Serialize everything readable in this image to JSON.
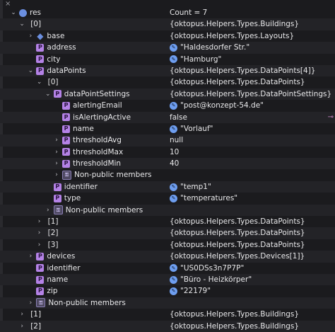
{
  "top_close": "×",
  "pencil_glyph": "✎",
  "rows": [
    {
      "indent": 0,
      "chev": "⌄",
      "icon": "obj",
      "icon_text": "",
      "name": "res",
      "value": "Count = 7",
      "pencil": false
    },
    {
      "indent": 1,
      "chev": "⌄",
      "icon": "none",
      "icon_text": "",
      "name": "[0]",
      "value": "{oktopus.Helpers.Types.Buildings}",
      "pencil": false
    },
    {
      "indent": 2,
      "chev": "›",
      "icon": "base",
      "icon_text": "◆",
      "name": "base",
      "value": "{oktopus.Helpers.Types.Layouts}",
      "pencil": false
    },
    {
      "indent": 2,
      "chev": "",
      "icon": "p",
      "icon_text": "P",
      "name": "address",
      "value": "\"Haldesdorfer Str.\"",
      "pencil": true
    },
    {
      "indent": 2,
      "chev": "",
      "icon": "p",
      "icon_text": "P",
      "name": "city",
      "value": "\"Hamburg\"",
      "pencil": true
    },
    {
      "indent": 2,
      "chev": "⌄",
      "icon": "p",
      "icon_text": "P",
      "name": "dataPoints",
      "value": "{oktopus.Helpers.Types.DataPoints[4]}",
      "pencil": false
    },
    {
      "indent": 3,
      "chev": "⌄",
      "icon": "none",
      "icon_text": "",
      "name": "[0]",
      "value": "{oktopus.Helpers.Types.DataPoints}",
      "pencil": false
    },
    {
      "indent": 4,
      "chev": "⌄",
      "icon": "p",
      "icon_text": "P",
      "name": "dataPointSettings",
      "value": "{oktopus.Helpers.Types.DataPointSettings}",
      "pencil": false
    },
    {
      "indent": 5,
      "chev": "",
      "icon": "p",
      "icon_text": "P",
      "name": "alertingEmail",
      "value": "\"post@konzept-54.de\"",
      "pencil": true
    },
    {
      "indent": 5,
      "chev": "",
      "icon": "p",
      "icon_text": "P",
      "name": "isAlertingActive",
      "value": "false",
      "pencil": false,
      "marker": true
    },
    {
      "indent": 5,
      "chev": "",
      "icon": "p",
      "icon_text": "P",
      "name": "name",
      "value": "\"Vorlauf\"",
      "pencil": true
    },
    {
      "indent": 5,
      "chev": "›",
      "icon": "p",
      "icon_text": "P",
      "name": "thresholdAvg",
      "value": "null",
      "pencil": false
    },
    {
      "indent": 5,
      "chev": "›",
      "icon": "p",
      "icon_text": "P",
      "name": "thresholdMax",
      "value": "10",
      "pencil": false
    },
    {
      "indent": 5,
      "chev": "›",
      "icon": "p",
      "icon_text": "P",
      "name": "thresholdMin",
      "value": "40",
      "pencil": false
    },
    {
      "indent": 5,
      "chev": "›",
      "icon": "np",
      "icon_text": "⚿",
      "name": "Non-public members",
      "value": "",
      "pencil": false
    },
    {
      "indent": 4,
      "chev": "",
      "icon": "p",
      "icon_text": "P",
      "name": "identifier",
      "value": "\"temp1\"",
      "pencil": true
    },
    {
      "indent": 4,
      "chev": "",
      "icon": "p",
      "icon_text": "P",
      "name": "type",
      "value": "\"temperatures\"",
      "pencil": true
    },
    {
      "indent": 4,
      "chev": "›",
      "icon": "np",
      "icon_text": "⚿",
      "name": "Non-public members",
      "value": "",
      "pencil": false
    },
    {
      "indent": 3,
      "chev": "›",
      "icon": "none",
      "icon_text": "",
      "name": "[1]",
      "value": "{oktopus.Helpers.Types.DataPoints}",
      "pencil": false
    },
    {
      "indent": 3,
      "chev": "›",
      "icon": "none",
      "icon_text": "",
      "name": "[2]",
      "value": "{oktopus.Helpers.Types.DataPoints}",
      "pencil": false
    },
    {
      "indent": 3,
      "chev": "›",
      "icon": "none",
      "icon_text": "",
      "name": "[3]",
      "value": "{oktopus.Helpers.Types.DataPoints}",
      "pencil": false
    },
    {
      "indent": 2,
      "chev": "›",
      "icon": "p",
      "icon_text": "P",
      "name": "devices",
      "value": "{oktopus.Helpers.Types.Devices[1]}",
      "pencil": false
    },
    {
      "indent": 2,
      "chev": "",
      "icon": "p",
      "icon_text": "P",
      "name": "identifier",
      "value": "\"US0DSs3n7P7P\"",
      "pencil": true
    },
    {
      "indent": 2,
      "chev": "",
      "icon": "p",
      "icon_text": "P",
      "name": "name",
      "value": "\"Büro - Heizkörper\"",
      "pencil": true
    },
    {
      "indent": 2,
      "chev": "",
      "icon": "p",
      "icon_text": "P",
      "name": "zip",
      "value": "\"22179\"",
      "pencil": true
    },
    {
      "indent": 2,
      "chev": "›",
      "icon": "np",
      "icon_text": "⚿",
      "name": "Non-public members",
      "value": "",
      "pencil": false
    },
    {
      "indent": 1,
      "chev": "›",
      "icon": "none",
      "icon_text": "",
      "name": "[1]",
      "value": "{oktopus.Helpers.Types.Buildings}",
      "pencil": false
    },
    {
      "indent": 1,
      "chev": "›",
      "icon": "none",
      "icon_text": "",
      "name": "[2]",
      "value": "{oktopus.Helpers.Types.Buildings}",
      "pencil": false
    }
  ],
  "marker_glyph": "⊸"
}
